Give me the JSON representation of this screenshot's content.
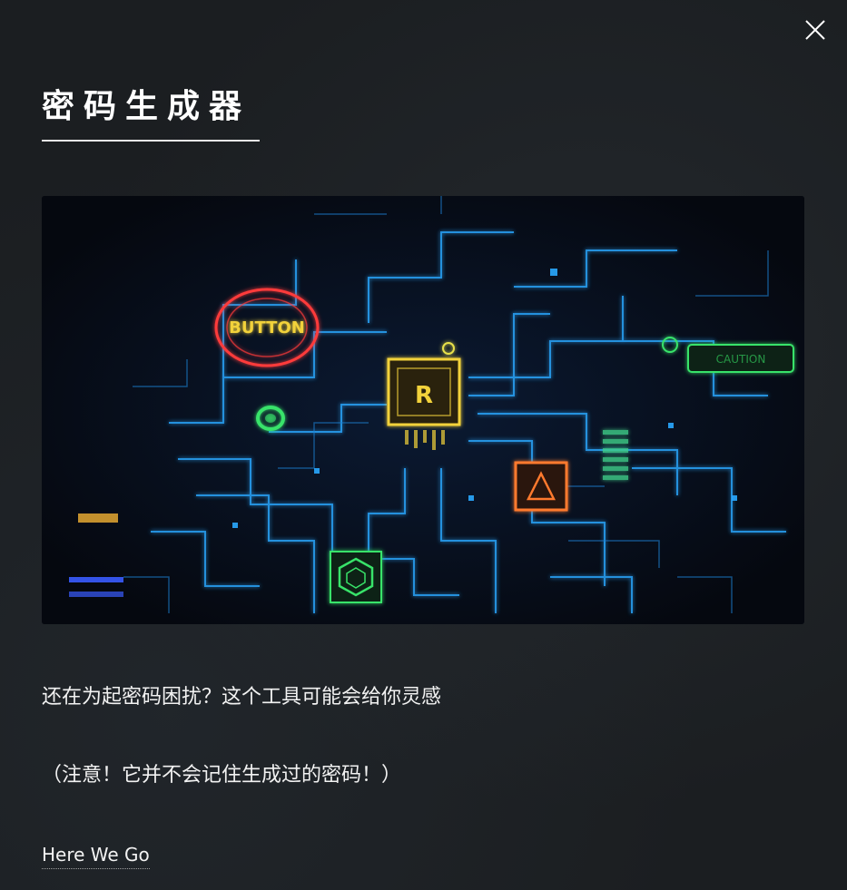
{
  "modal": {
    "title": "密码生成器",
    "description_line1": "还在为起密码困扰？这个工具可能会给你灵感",
    "description_line2": "（注意！它并不会记住生成过的密码！）",
    "cta_label": "Here We Go"
  },
  "hero": {
    "chip_labels": {
      "button": "BUTTON",
      "center": "R",
      "caution": "CAUTION"
    }
  },
  "icons": {
    "close": "close-icon"
  },
  "colors": {
    "background": "#1b1e21",
    "text": "#ffffff",
    "circuit_blue": "#2aa8ff",
    "chip_yellow": "#f2d23a",
    "chip_red": "#ff3b3b",
    "chip_green": "#39e36a",
    "chip_orange": "#ff7a2e"
  }
}
